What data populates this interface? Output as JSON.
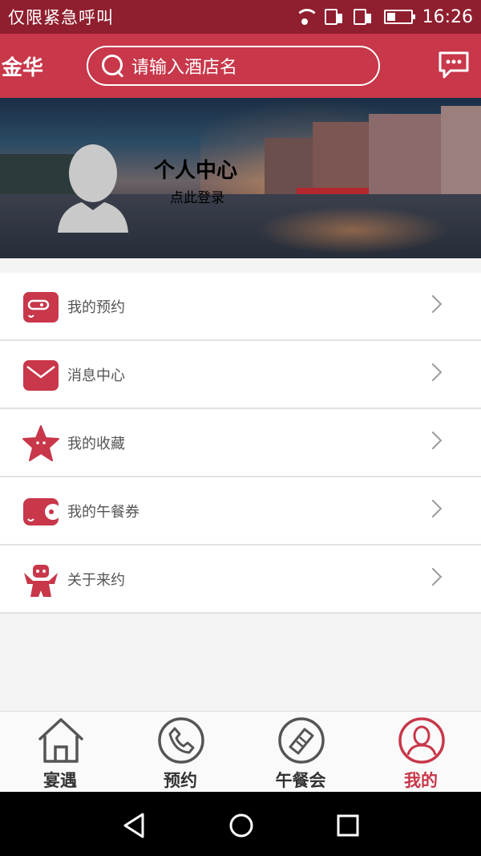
{
  "status_bar": {
    "carrier_text": "仅限紧急呼叫",
    "time": "16:26",
    "icons": [
      "wifi-icon",
      "sim-1-icon",
      "sim-2-icon",
      "battery-icon"
    ]
  },
  "header": {
    "city": "金华",
    "search_placeholder": "请输入酒店名",
    "message_icon": "chat-bubble-icon"
  },
  "profile": {
    "title": "个人中心",
    "login_prompt": "点此登录"
  },
  "menu": {
    "items": [
      {
        "label": "我的预约",
        "icon": "wallet-icon"
      },
      {
        "label": "消息中心",
        "icon": "envelope-icon"
      },
      {
        "label": "我的收藏",
        "icon": "star-icon"
      },
      {
        "label": "我的午餐券",
        "icon": "coupon-icon"
      },
      {
        "label": "关于来约",
        "icon": "mascot-icon"
      }
    ]
  },
  "tabbar": {
    "tabs": [
      {
        "label": "宴遇",
        "icon": "home-icon",
        "active": false
      },
      {
        "label": "预约",
        "icon": "phone-icon",
        "active": false
      },
      {
        "label": "午餐会",
        "icon": "ticket-icon",
        "active": false
      },
      {
        "label": "我的",
        "icon": "user-icon",
        "active": true
      }
    ]
  },
  "colors": {
    "brand": "#c8374a",
    "status_bar": "#8f1e2e",
    "tab_inactive": "#333333"
  }
}
